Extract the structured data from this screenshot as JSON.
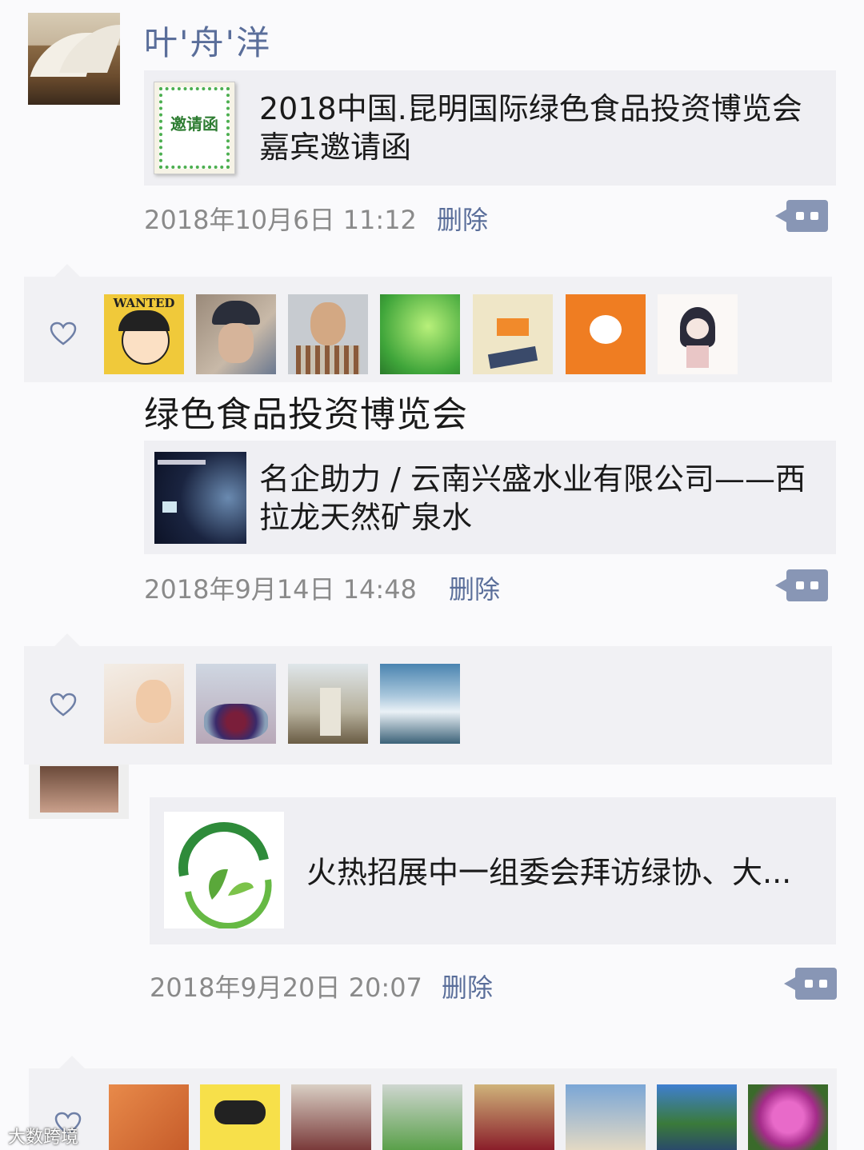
{
  "user": {
    "name": "叶'舟'洋"
  },
  "posts": [
    {
      "card_title": "2018中国.昆明国际绿色食品投资博览会嘉宾邀请函",
      "thumb_icon": "invitation-poster",
      "thumb_text": "邀请函",
      "time": "2018年10月6日 11:12",
      "delete": "删除"
    },
    {
      "text": "绿色食品投资博览会",
      "card_title": "名企助力 / 云南兴盛水业有限公司——西拉龙天然矿泉水",
      "thumb_icon": "water-ad-image",
      "time": "2018年9月14日 14:48",
      "delete": "删除"
    },
    {
      "card_title": "火热招展中一组委会拜访绿协、大...",
      "thumb_icon": "green-leaf-logo",
      "time": "2018年9月20日 20:07",
      "delete": "删除"
    }
  ],
  "likes": {
    "panel1": [
      "wanted-cartoon",
      "cap-man",
      "older-man",
      "green-leaves",
      "running-illustration",
      "egg-cartoon",
      "girl-cartoon"
    ],
    "panel2": [
      "woman-portrait",
      "flower-cluster",
      "man-by-tree",
      "sea-of-clouds"
    ],
    "panel3": [
      "glasses-orange",
      "pop-art-face",
      "woman-standing",
      "woman-sunglasses",
      "woman-wheat-field",
      "castle-building",
      "lake-landscape",
      "pink-flower"
    ]
  },
  "wanted_text": "WANTED",
  "watermark": "大数跨境",
  "colors": {
    "link_blue": "#5a6e9a",
    "card_bg": "#efeff3",
    "comment_btn": "#8896b5"
  }
}
